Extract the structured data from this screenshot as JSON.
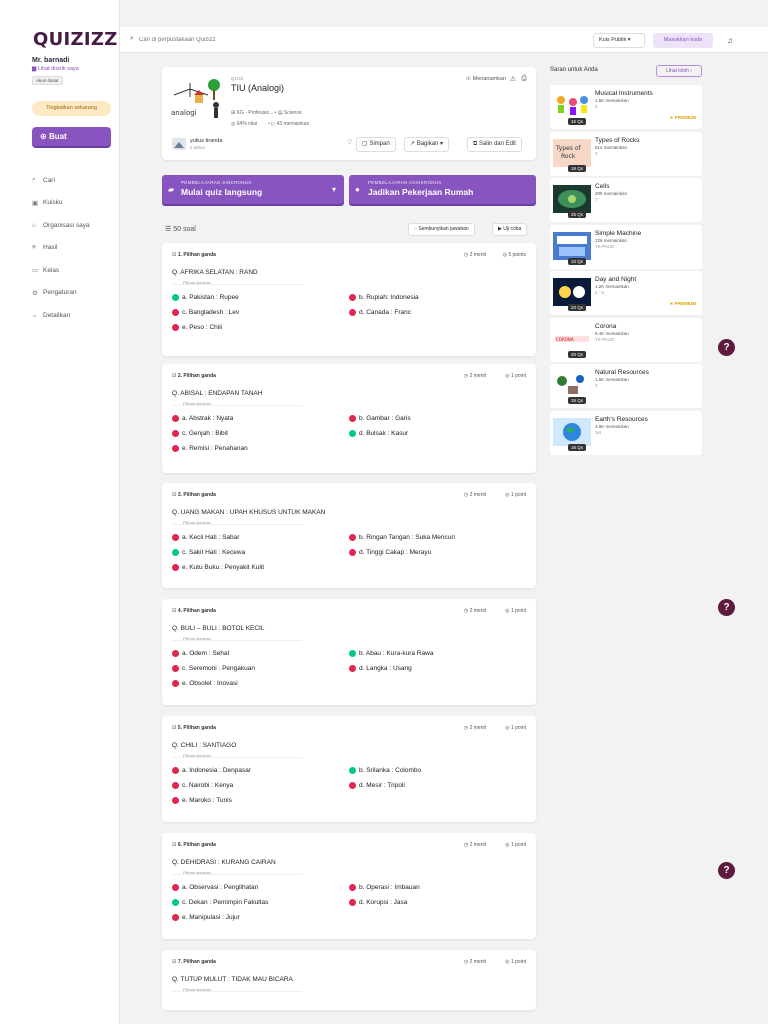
{
  "brand": "QUIZIZZ",
  "user": {
    "name": "Mr. barnadi",
    "profile_link": "Lihat distrik saya",
    "account_badge": "Akun dasar",
    "upgrade": "Tingkatkan sekarang"
  },
  "sidebar": {
    "create": "Buat",
    "items": [
      {
        "icon": "search-icon",
        "label": "Cari"
      },
      {
        "icon": "quiz-icon",
        "label": "Kuisku"
      },
      {
        "icon": "organization-icon",
        "label": "Organisasi saya"
      },
      {
        "icon": "results-icon",
        "label": "Hasil"
      },
      {
        "icon": "class-icon",
        "label": "Kelas"
      },
      {
        "icon": "settings-icon",
        "label": "Pengaturan"
      },
      {
        "icon": "chevron-down-icon",
        "label": "Detailkan"
      }
    ]
  },
  "topbar": {
    "search_placeholder": "Cari di perpustakaan Quizizz",
    "public_select": "Kuis Publik",
    "enter_code": "Masukkan kode"
  },
  "quiz": {
    "type": "QUIZ",
    "title": "TIU (Analogi)",
    "grade": "KG - Professio...",
    "subject": "Science",
    "accuracy": "64% nilai",
    "plays": "43 memainkan",
    "embed": "Menanamkan",
    "author": "yulius tiranda",
    "author_ago": "2 tahun",
    "actions": {
      "save": "Simpan",
      "share": "Bagikan",
      "copy": "Salin dan Edit"
    }
  },
  "cta": {
    "live": {
      "sub": "PEMBELAJARAN SINKRONUS",
      "label": "Mulai quiz langsung"
    },
    "homework": {
      "sub": "PEMBELAJARAN ASINKRONUS",
      "label": "Jadikan Pekerjaan Rumah"
    }
  },
  "questions_header": {
    "count": "50 soal",
    "hide_answers": "Sembunyikan jawaban",
    "try": "Uji coba"
  },
  "answer_choices_label": "Pilihan jawaban",
  "questions": [
    {
      "head": "1. Pilihan ganda",
      "time": "2 menit",
      "points": "5 points",
      "text": "Q. AFRIKA SELATAN : RAND",
      "options": [
        {
          "t": "a. Pakistan : Rupee",
          "c": "g"
        },
        {
          "t": "b. Rupiah: Indonesia",
          "c": "r"
        },
        {
          "t": "c. Bangladesh : Lev",
          "c": "r"
        },
        {
          "t": "d. Canada : Franc",
          "c": "r"
        },
        {
          "t": "e. Peso : Chili",
          "c": "r"
        }
      ]
    },
    {
      "head": "2. Pilihan ganda",
      "time": "2 menit",
      "points": "1 point",
      "text": "Q. ABISAL : ENDAPAN TANAH",
      "options": [
        {
          "t": "a. Abstrak : Nyata",
          "c": "r"
        },
        {
          "t": "b. Gambar : Garis",
          "c": "r"
        },
        {
          "t": "c. Genjah : Bibit",
          "c": "r"
        },
        {
          "t": "d. Bulsak : Kasur",
          "c": "g"
        },
        {
          "t": "e. Remisi : Penahanan",
          "c": "r"
        }
      ]
    },
    {
      "head": "3. Pilihan ganda",
      "time": "2 menit",
      "points": "1 point",
      "text": "Q. UANG MAKAN : UPAH KHUSUS UNTUK MAKAN",
      "options": [
        {
          "t": "a. Kecil Hati : Sabar",
          "c": "r"
        },
        {
          "t": "b. Ringan Tangan : Suka Mencuri",
          "c": "r"
        },
        {
          "t": "c. Sakit Hati : Kecewa",
          "c": "g"
        },
        {
          "t": "d. Tinggi Cakap : Merayu",
          "c": "r"
        },
        {
          "t": "e. Kutu Buku : Penyakit Kulit",
          "c": "r"
        }
      ]
    },
    {
      "head": "4. Pilihan ganda",
      "time": "2 menit",
      "points": "1 point",
      "text": "Q. BULI – BULI : BOTOL KECIL",
      "options": [
        {
          "t": "a. Odem : Sehat",
          "c": "r"
        },
        {
          "t": "b. Abau : Kura-kura Rawa",
          "c": "g"
        },
        {
          "t": "c. Seremoni : Pengakuan",
          "c": "r"
        },
        {
          "t": "d. Langka : Usang",
          "c": "r"
        },
        {
          "t": "e. Obsolet : Inovasi",
          "c": "r"
        }
      ]
    },
    {
      "head": "5. Pilihan ganda",
      "time": "2 menit",
      "points": "1 point",
      "text": "Q. CHILI : SANTIAGO",
      "options": [
        {
          "t": "a. Indonesia : Denpasar",
          "c": "r"
        },
        {
          "t": "b. Srilanka : Colombo",
          "c": "g"
        },
        {
          "t": "c. Nairobi : Kenya",
          "c": "r"
        },
        {
          "t": "d. Mesir : Tripoli",
          "c": "r"
        },
        {
          "t": "e. Maroko : Tunis",
          "c": "r"
        }
      ]
    },
    {
      "head": "6. Pilihan ganda",
      "time": "2 menit",
      "points": "1 point",
      "text": "Q. DEHIDRASI : KURANG CAIRAN",
      "options": [
        {
          "t": "a. Observasi : Penglihatan",
          "c": "r"
        },
        {
          "t": "b. Operasi : Imbauan",
          "c": "r"
        },
        {
          "t": "c. Dekan : Pemimpin Fakultas",
          "c": "g"
        },
        {
          "t": "d. Korupsi : Jasa",
          "c": "r"
        },
        {
          "t": "e. Manipulasi : Jujur",
          "c": "r"
        }
      ]
    },
    {
      "head": "7. Pilihan ganda",
      "time": "2 menit",
      "points": "1 point",
      "text": "Q. TUTUP MULUT : TIDAK MAU BICARA",
      "options": []
    }
  ],
  "recommendations": {
    "title": "Saran untuk Anda",
    "more": "Lihat lebih",
    "premium": "PREMIUM",
    "items": [
      {
        "name": "Musical Instruments",
        "plays": "1.5K memainkan",
        "grade": "4",
        "qs": "15 Qs",
        "premium": true,
        "img": "musical"
      },
      {
        "name": "Types of Rocks",
        "plays": "814 memainkan",
        "grade": "2",
        "qs": "18 Qs",
        "premium": false,
        "img": "rocks"
      },
      {
        "name": "Cells",
        "plays": "205 memainkan",
        "grade": "7",
        "qs": "25 Qs",
        "premium": false,
        "img": "cells"
      },
      {
        "name": "Simple Machine",
        "plays": "226 memainkan",
        "grade": "TK-PAUD",
        "qs": "10 Qs",
        "premium": false,
        "img": "machine"
      },
      {
        "name": "Day and Night",
        "plays": "1.2K memainkan",
        "grade": "2 - 5",
        "qs": "20 Qs",
        "premium": true,
        "img": "daynight"
      },
      {
        "name": "Corona",
        "plays": "6.4K memainkan",
        "grade": "TK-PAUD",
        "qs": "20 Qs",
        "premium": false,
        "img": "corona"
      },
      {
        "name": "Natural Resources",
        "plays": "1.5K memainkan",
        "grade": "2",
        "qs": "15 Qs",
        "premium": false,
        "img": "natural"
      },
      {
        "name": "Earth's Resources",
        "plays": "3.9K memainkan",
        "grade": "1st",
        "qs": "16 Qs",
        "premium": false,
        "img": "earth"
      }
    ]
  },
  "colors": {
    "accent": "#8854c0",
    "correct": "#00c985",
    "incorrect": "#e2264d",
    "brand": "#461a42"
  }
}
